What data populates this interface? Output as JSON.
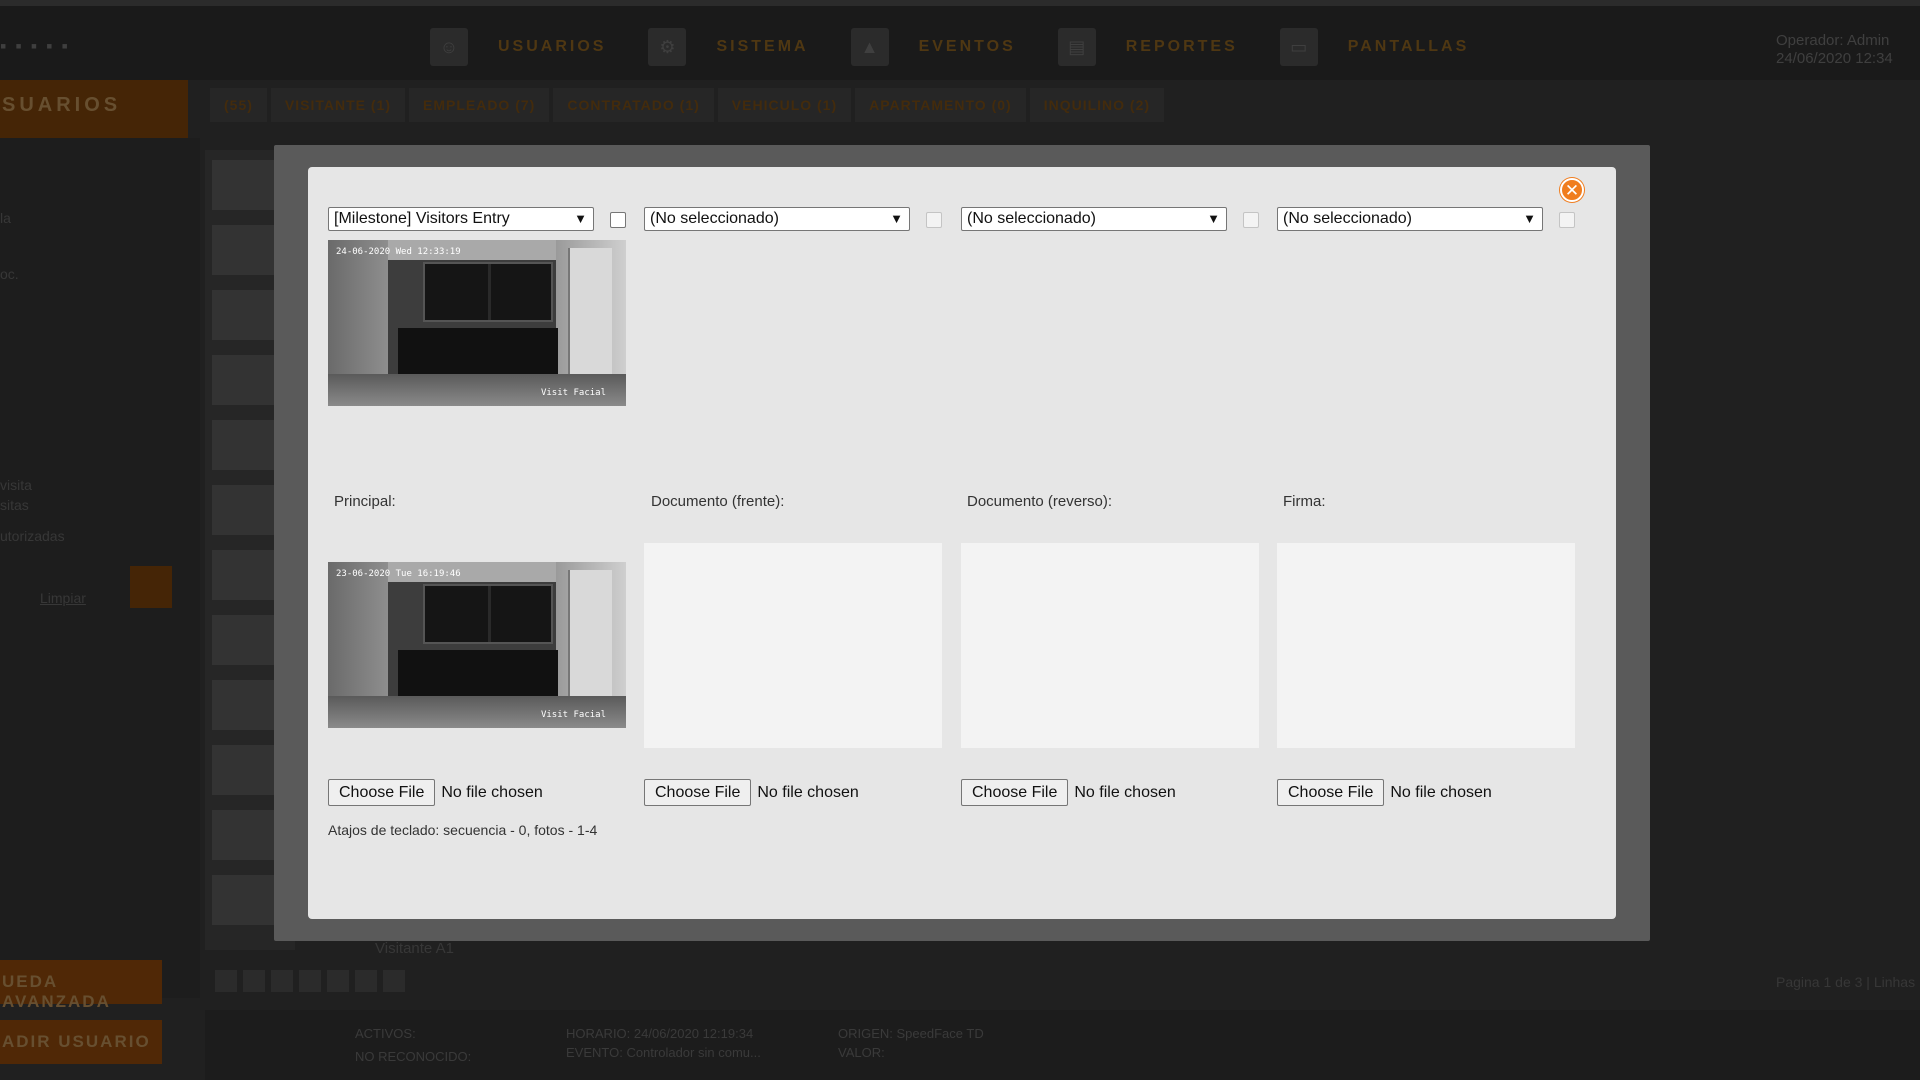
{
  "app": {
    "nav": [
      {
        "label": "USUARIOS",
        "icon": "user-icon"
      },
      {
        "label": "SISTEMA",
        "icon": "system-icon"
      },
      {
        "label": "EVENTOS",
        "icon": "bell-icon"
      },
      {
        "label": "REPORTES",
        "icon": "report-icon"
      },
      {
        "label": "PANTALLAS",
        "icon": "screen-icon"
      }
    ],
    "operator_line1": "Operador: Admin",
    "operator_line2": "24/06/2020  12:34",
    "side_header": "SUARIOS",
    "side_texts": [
      "la",
      "oc.",
      "visita",
      "sitas",
      "utorizadas"
    ],
    "clear_label": "Limpiar",
    "advanced_search": "UEDA AVANZADA",
    "add_user": "ADIR USUARIO",
    "tabs": [
      "(55)",
      "VISITANTE (1)",
      "EMPLEADO (7)",
      "CONTRATADO (1)",
      "VEHICULO (1)",
      "APARTAMENTO (0)",
      "INQUILINO (2)"
    ],
    "list_item": "Visitante A1",
    "page_info": "Pagina 1 de 3 | Linhas",
    "status": {
      "activos": "ACTIVOS:",
      "no_reconocido": "NO RECONOCIDO:",
      "horario": "HORARIO: 24/06/2020 12:19:34",
      "evento": "EVENTO:   Controlador sin comu...",
      "origen": "ORIGEN:   SpeedFace TD",
      "valor": "VALOR:"
    }
  },
  "modal": {
    "close_icon": "close-icon",
    "cameras": [
      {
        "selected": "[Milestone] Visitors Entry",
        "checked": false,
        "enabled": true
      },
      {
        "selected": "(No seleccionado)",
        "checked": false,
        "enabled": false
      },
      {
        "selected": "(No seleccionado)",
        "checked": false,
        "enabled": false
      },
      {
        "selected": "(No seleccionado)",
        "checked": false,
        "enabled": false
      }
    ],
    "live_feed": {
      "timestamp": "24-06-2020 Wed 12:33:19",
      "camera": "Visit Facial"
    },
    "slots": [
      {
        "label": "Principal:"
      },
      {
        "label": "Documento (frente):"
      },
      {
        "label": "Documento (reverso):"
      },
      {
        "label": "Firma:"
      }
    ],
    "captured_feed": {
      "timestamp": "23-06-2020 Tue 16:19:46",
      "camera": "Visit Facial"
    },
    "file_button": "Choose File",
    "file_status": "No file chosen",
    "shortcuts": "Atajos de teclado: secuencia - 0, fotos - 1-4"
  },
  "colors": {
    "accent": "#f07d1e",
    "modal_bg": "#e6e6e6",
    "slot_bg": "#f3f3f3"
  }
}
